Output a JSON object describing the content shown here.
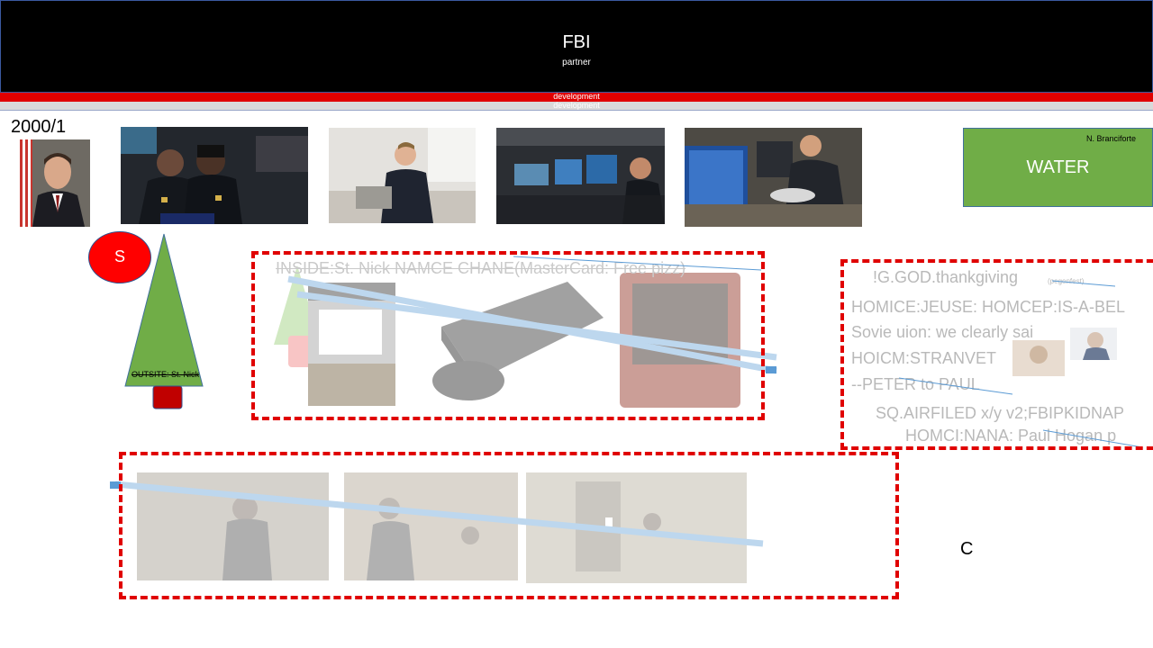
{
  "header": {
    "title": "FBI",
    "subtitle": "partner",
    "dev_label_1": "development",
    "dev_label_2": "development"
  },
  "date_label": "2000/1",
  "water_box": {
    "name": "N. Branciforte",
    "label": "WATER"
  },
  "s_circle": {
    "label": "S"
  },
  "tree": {
    "label": "OUTSITE: St. Nick"
  },
  "box1": {
    "line": "INSIDE:St. Nick NAMCE CHANE(MasterCard: Free pizz)"
  },
  "box2": {
    "lines": [
      "!G.GOD.thankgiving",
      "HOMICE:JEUSE: HOMCEP:IS-A-BEL",
      "Sovie uion: we clearly sai",
      "HOICM:STRANVET",
      "--PETER to PAUL",
      "SQ.AIRFILED x/y v2;FBIPKIDNAP",
      "HOMCI:NANA: Paul Hogan p"
    ],
    "small_note": "(pegenfest)"
  },
  "c_label": "C",
  "colors": {
    "header_bg": "#000000",
    "red_bar": "#e00000",
    "water_green": "#70ad47",
    "tree_green": "#70ad47",
    "s_red": "#ff0000",
    "dash_red": "#e00000"
  }
}
